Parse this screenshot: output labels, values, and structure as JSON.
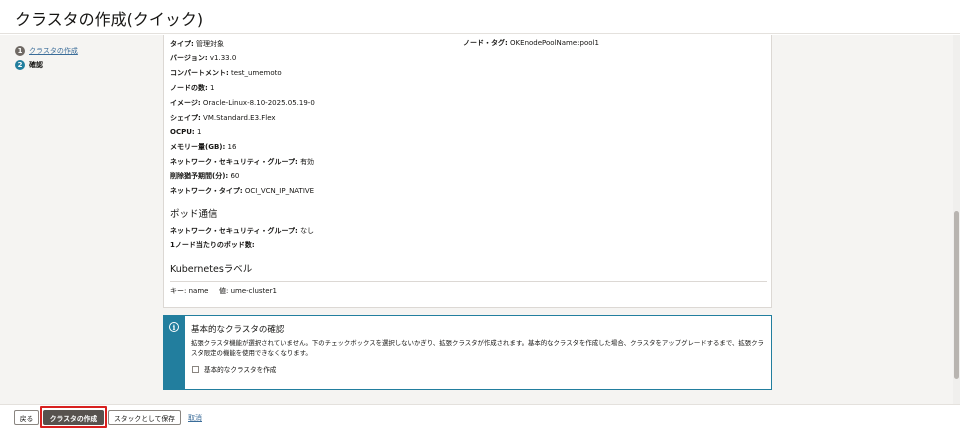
{
  "header": {
    "title": "クラスタの作成(クイック)"
  },
  "steps": [
    {
      "number": "1",
      "label": "クラスタの作成"
    },
    {
      "number": "2",
      "label": "確認"
    }
  ],
  "node_pool": {
    "type": {
      "label": "タイプ:",
      "value": "管理対象"
    },
    "node_tag": {
      "label": "ノード・タグ:",
      "value": "OKEnodePoolName:pool1"
    },
    "version": {
      "label": "バージョン:",
      "value": "v1.33.0"
    },
    "compartment": {
      "label": "コンパートメント:",
      "value": "test_umemoto"
    },
    "node_count": {
      "label": "ノードの数:",
      "value": "1"
    },
    "image": {
      "label": "イメージ:",
      "value": "Oracle-Linux-8.10-2025.05.19-0"
    },
    "shape": {
      "label": "シェイプ:",
      "value": "VM.Standard.E3.Flex"
    },
    "ocpu": {
      "label": "OCPU:",
      "value": "1"
    },
    "memory": {
      "label": "メモリー量(GB):",
      "value": "16"
    },
    "nsg": {
      "label": "ネットワーク・セキュリティ・グループ:",
      "value": "有効"
    },
    "eviction": {
      "label": "削除猶予期間(分):",
      "value": "60"
    },
    "network_type": {
      "label": "ネットワーク・タイプ:",
      "value": "OCI_VCN_IP_NATIVE"
    }
  },
  "pod_comm": {
    "heading": "ポッド通信",
    "nsg": {
      "label": "ネットワーク・セキュリティ・グループ:",
      "value": "なし"
    },
    "pods_per_node": {
      "label": "1ノード当たりのポッド数:",
      "value": ""
    }
  },
  "k8s_labels": {
    "heading": "Kubernetesラベル",
    "key_label": "キー:",
    "key_value": "name",
    "val_label": "値:",
    "val_value": "ume-cluster1"
  },
  "info": {
    "icon": "info-icon",
    "title": "基本的なクラスタの確認",
    "description": "拡張クラスタ機能が選択されていません。下のチェックボックスを選択しないかぎり、拡張クラスタが作成されます。基本的なクラスタを作成した場合、クラスタをアップグレードするまで、拡張クラスタ限定の機能を使用できなくなります。",
    "checkbox_label": "基本的なクラスタを作成",
    "accent": "#227e9e"
  },
  "footer": {
    "back": "戻る",
    "create": "クラスタの作成",
    "save_stack": "スタックとして保存",
    "cancel": "取消"
  },
  "colors": {
    "highlight": "#d8201f",
    "primary_button": "#57524e",
    "link": "#3a6c99"
  }
}
